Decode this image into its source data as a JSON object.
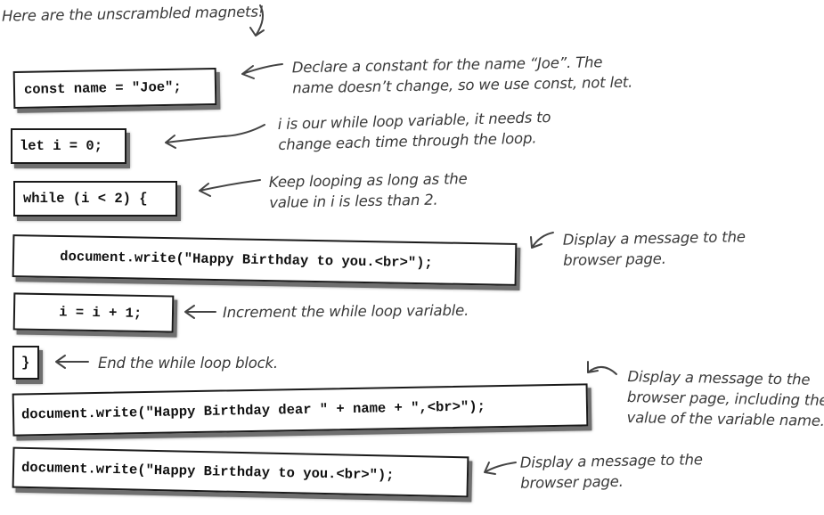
{
  "heading": "Here are the unscrambled magnets!",
  "magnets": [
    {
      "code": "const name = \"Joe\";",
      "annotation": [
        "Declare a constant for the name “Joe”. The",
        "name doesn’t change, so we use const, not let."
      ]
    },
    {
      "code": "let i = 0;",
      "annotation": [
        "i is our while loop variable, it needs to",
        "change each time through the loop."
      ]
    },
    {
      "code": "while (i < 2) {",
      "annotation": [
        "Keep looping as long as the",
        "value in i is less than 2."
      ]
    },
    {
      "code": "    document.write(\"Happy Birthday to you.<br>\");",
      "annotation": [
        "Display a message to the",
        "browser page."
      ]
    },
    {
      "code": "    i = i + 1;",
      "annotation": [
        "Increment the while loop variable."
      ]
    },
    {
      "code": "}",
      "annotation": [
        "End the while loop block."
      ]
    },
    {
      "code": "document.write(\"Happy Birthday dear \" + name + \",<br>\");",
      "annotation": [
        "Display a message to the",
        "browser page, including the",
        "value of the variable name."
      ]
    },
    {
      "code": "document.write(\"Happy Birthday to you.<br>\");",
      "annotation": [
        "Display a message to the",
        "browser page."
      ]
    }
  ]
}
